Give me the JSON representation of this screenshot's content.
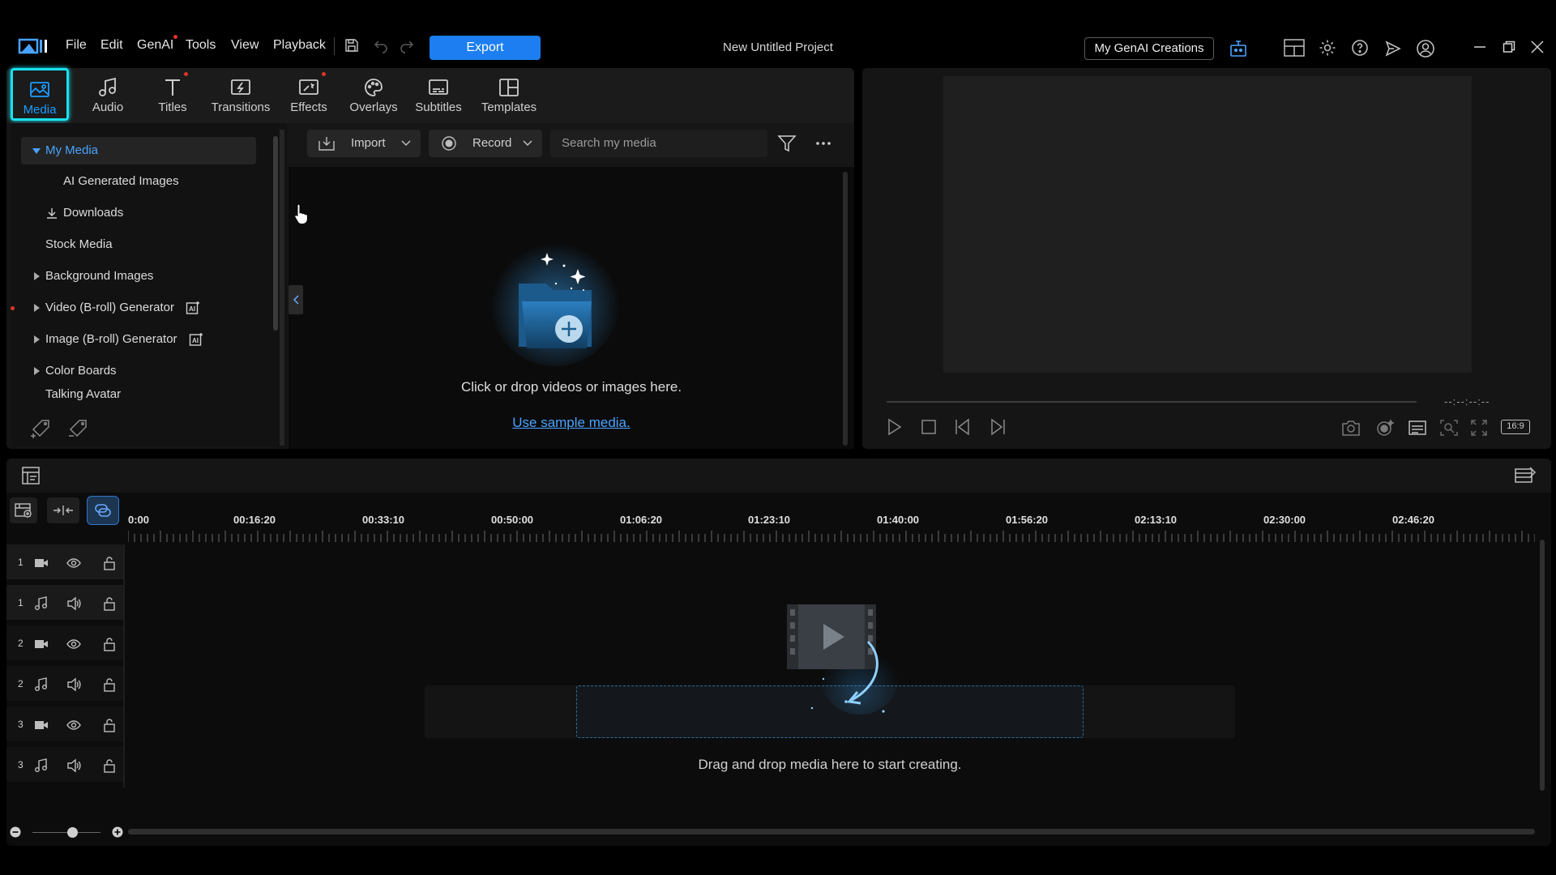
{
  "menu": {
    "file": "File",
    "edit": "Edit",
    "genai": "GenAI",
    "tools": "Tools",
    "view": "View",
    "playback": "Playback"
  },
  "export_label": "Export",
  "project_title": "New Untitled Project",
  "genai_creations_label": "My GenAI Creations",
  "tabs": [
    {
      "label": "Media",
      "icon": "media-icon"
    },
    {
      "label": "Audio",
      "icon": "music-note-icon"
    },
    {
      "label": "Titles",
      "icon": "text-t-icon"
    },
    {
      "label": "Transitions",
      "icon": "transition-icon"
    },
    {
      "label": "Effects",
      "icon": "effects-icon"
    },
    {
      "label": "Overlays",
      "icon": "overlay-icon"
    },
    {
      "label": "Subtitles",
      "icon": "subtitles-icon"
    },
    {
      "label": "Templates",
      "icon": "templates-icon"
    }
  ],
  "library_tree": [
    {
      "label": "My Media"
    },
    {
      "label": "AI Generated Images"
    },
    {
      "label": "Downloads"
    },
    {
      "label": "Stock Media"
    },
    {
      "label": "Background Images"
    },
    {
      "label": "Video (B-roll) Generator"
    },
    {
      "label": "Image (B-roll) Generator"
    },
    {
      "label": "Color Boards"
    },
    {
      "label": "Talking Avatar"
    }
  ],
  "media_toolbar": {
    "import_label": "Import",
    "record_label": "Record",
    "search_placeholder": "Search my media"
  },
  "media_area": {
    "drop_hint": "Click or drop videos or images here.",
    "sample_link": "Use sample media."
  },
  "preview": {
    "timecode": "--:--:--:--",
    "aspect_ratio": "16:9"
  },
  "timeline": {
    "ruler": [
      "0:00",
      "00:16:20",
      "00:33:10",
      "00:50:00",
      "01:06:20",
      "01:23:10",
      "01:40:00",
      "01:56:20",
      "02:13:10",
      "02:30:00",
      "02:46:20"
    ],
    "tracks": [
      {
        "num": "1",
        "type": "video"
      },
      {
        "num": "1",
        "type": "audio"
      },
      {
        "num": "2",
        "type": "video"
      },
      {
        "num": "2",
        "type": "audio"
      },
      {
        "num": "3",
        "type": "video"
      },
      {
        "num": "3",
        "type": "audio"
      }
    ],
    "drop_hint": "Drag and drop media here to start creating."
  },
  "colors": {
    "accent": "#1c7ef0",
    "active_tab_outline": "#19e0f0",
    "notification_dot": "#e0342c",
    "link": "#4aa3ff"
  }
}
